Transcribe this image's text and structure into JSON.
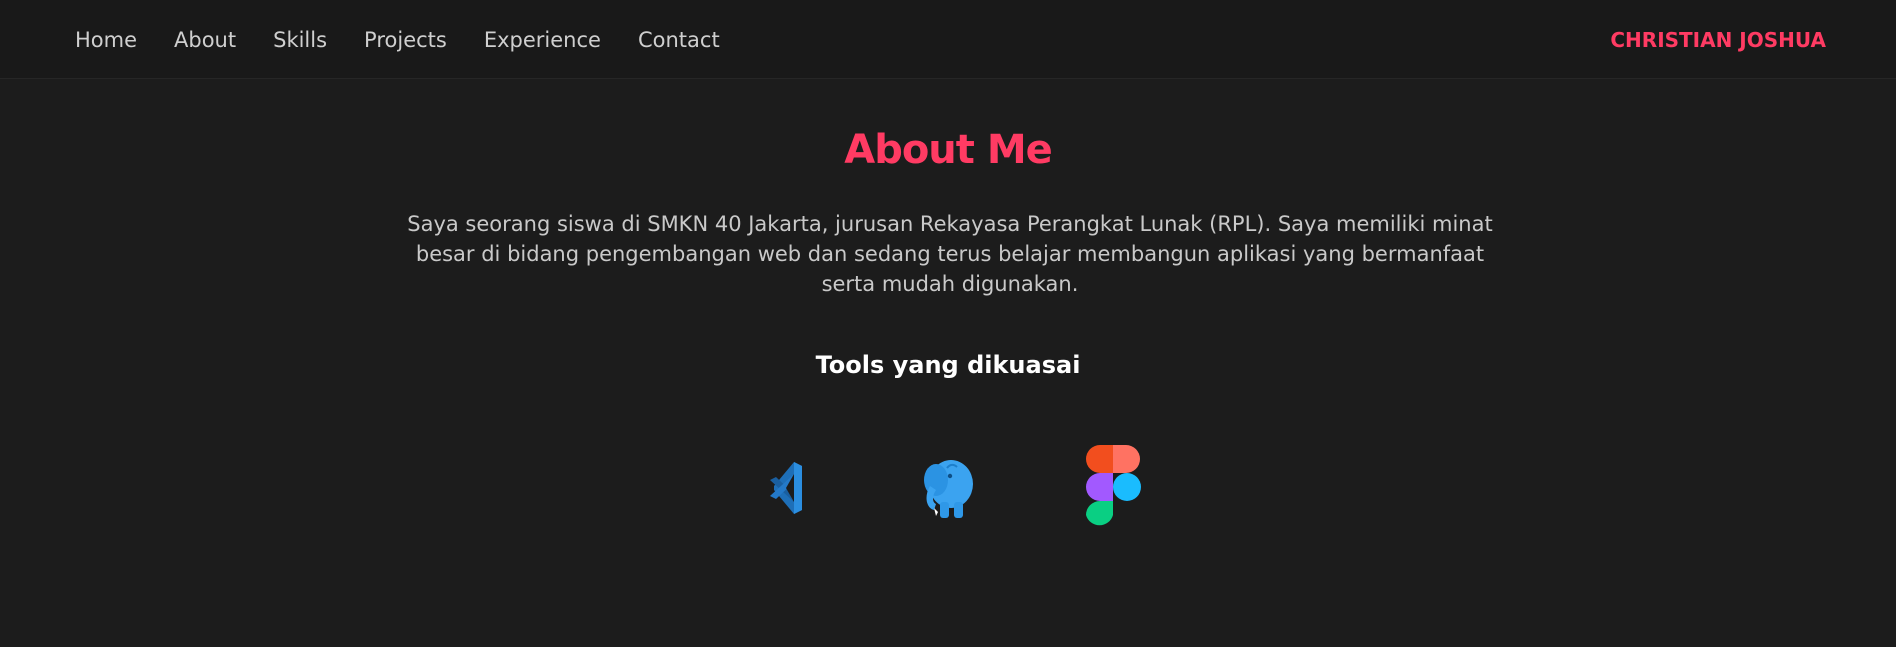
{
  "nav": {
    "links": [
      {
        "label": "Home"
      },
      {
        "label": "About"
      },
      {
        "label": "Skills"
      },
      {
        "label": "Projects"
      },
      {
        "label": "Experience"
      },
      {
        "label": "Contact"
      }
    ],
    "brand": "CHRISTIAN JOSHUA"
  },
  "about": {
    "title": "About Me",
    "description": "Saya seorang siswa di SMKN 40 Jakarta, jurusan Rekayasa Perangkat Lunak (RPL). Saya memiliki minat besar di bidang pengembangan web dan sedang terus belajar membangun aplikasi yang bermanfaat serta mudah digunakan.",
    "tools_heading": "Tools yang dikuasai",
    "tools": [
      {
        "icon": "vscode-icon"
      },
      {
        "icon": "elephant-icon"
      },
      {
        "icon": "figma-icon"
      }
    ]
  },
  "colors": {
    "background": "#1c1c1c",
    "navbar": "#191919",
    "accent": "#ff3b63",
    "text": "#c9c9c9",
    "heading": "#ffffff"
  }
}
